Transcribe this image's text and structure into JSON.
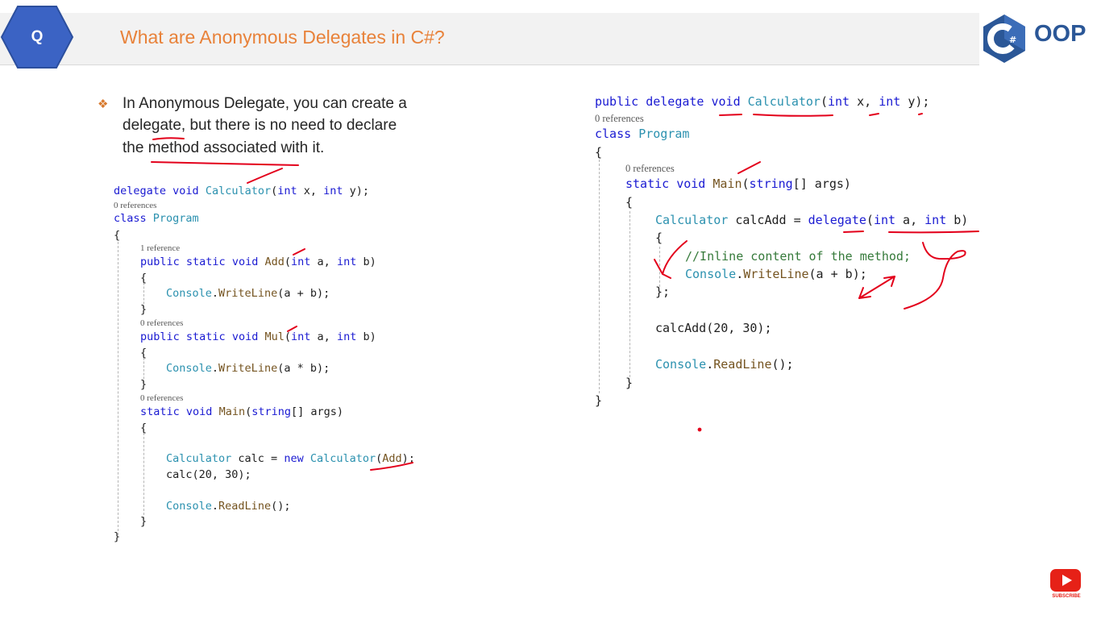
{
  "header": {
    "badge": "Q",
    "title": "What are Anonymous Delegates in C#?",
    "logo_glyph": "#",
    "logo_text": "OOP"
  },
  "bullet": {
    "icon": "❖",
    "lines": [
      "In Anonymous Delegate, you can create a",
      "delegate, but there is no need to declare",
      "the method associated with it."
    ]
  },
  "code_left": {
    "refs": [
      "0 references",
      "1 reference",
      "0 references",
      "0 references"
    ],
    "delegate_decl": {
      "k1": "delegate",
      "k2": "void",
      "type": "Calculator",
      "p1": "(",
      "k3": "int",
      "p2": " x, ",
      "k4": "int",
      "p3": " y);"
    },
    "class_decl": {
      "kw": "class",
      "name": "Program"
    },
    "open_brace": "{",
    "close_brace": "}",
    "add_sig": {
      "k1": "public",
      "k2": "static",
      "k3": "void",
      "name": "Add",
      "p1": "(",
      "k4": "int",
      "p2": " a, ",
      "k5": "int",
      "p3": " b)"
    },
    "add_body": {
      "type": "Console",
      "dot": ".",
      "method": "WriteLine",
      "args": "(a + b);"
    },
    "mul_sig": {
      "k1": "public",
      "k2": "static",
      "k3": "void",
      "name": "Mul",
      "p1": "(",
      "k4": "int",
      "p2": " a, ",
      "k5": "int",
      "p3": " b)"
    },
    "mul_body": {
      "type": "Console",
      "dot": ".",
      "method": "WriteLine",
      "args": "(a * b);"
    },
    "main_sig": {
      "k1": "static",
      "k2": "void",
      "name": "Main",
      "p1": "(",
      "k3": "string",
      "p2": "[] args)"
    },
    "calc_decl": {
      "type": "Calculator",
      "p1": " calc = ",
      "kw": "new",
      "type2": "Calculator",
      "p2": "(",
      "method": "Add",
      "p3": ");"
    },
    "calc_call": "calc(20, 30);",
    "readline": {
      "type": "Console",
      "dot": ".",
      "method": "ReadLine",
      "args": "();"
    }
  },
  "code_right": {
    "refs": [
      "0 references",
      "0 references"
    ],
    "delegate_decl": {
      "k1": "public",
      "k2": "delegate",
      "k3": "void",
      "type": "Calculator",
      "p1": "(",
      "k4": "int",
      "p2": " x, ",
      "k5": "int",
      "p3": " y);"
    },
    "class_decl": {
      "kw": "class",
      "name": "Program"
    },
    "open_brace": "{",
    "close_brace": "}",
    "main_sig": {
      "k1": "static",
      "k2": "void",
      "name": "Main",
      "p1": "(",
      "k3": "string",
      "p2": "[] args)"
    },
    "anon_decl": {
      "type": "Calculator",
      "p1": " calcAdd = ",
      "kw": "delegate",
      "p2": "(",
      "k2": "int",
      "p3": " a, ",
      "k3": "int",
      "p4": " b)"
    },
    "comment": "//Inline content of the method;",
    "writeline": {
      "type": "Console",
      "dot": ".",
      "method": "WriteLine",
      "args": "(a + b);"
    },
    "end_anon": "};",
    "call": "calcAdd(20, 30);",
    "readline": {
      "type": "Console",
      "dot": ".",
      "method": "ReadLine",
      "args": "();"
    }
  },
  "subscribe": {
    "label": "SUBSCRIBE"
  },
  "colors": {
    "title": "#e8823a",
    "badge": "#3b63c4",
    "keyword": "#1a1ad2",
    "type": "#2b91af",
    "method": "#74531f",
    "comment": "#357a3a",
    "annotation": "#e3001b",
    "logo": "#2b5797"
  }
}
